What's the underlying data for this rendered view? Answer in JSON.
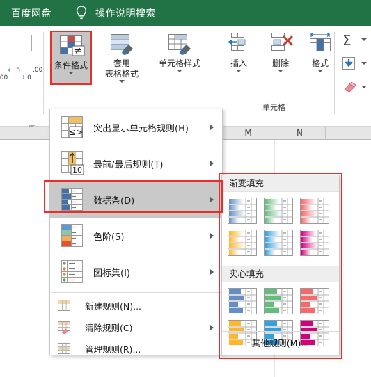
{
  "titlebar": {
    "app_name": "百度网盘",
    "bulb_icon": "lightbulb-icon",
    "tell_me": "操作说明搜索",
    "background_color": "#217346"
  },
  "ribbon": {
    "decimal_increase": "←.0\n.00",
    "decimal_decrease": ".00\n→.0",
    "buttons": [
      {
        "id": "conditional-formatting",
        "label": "条件格式",
        "selected": true
      },
      {
        "id": "format-as-table",
        "label_line1": "套用",
        "label_line2": "表格格式",
        "selected": false
      },
      {
        "id": "cell-styles",
        "label": "单元格样式",
        "selected": false
      },
      {
        "id": "insert",
        "label": "插入",
        "selected": false
      },
      {
        "id": "delete",
        "label": "删除",
        "selected": false
      },
      {
        "id": "format",
        "label": "格式",
        "selected": false
      }
    ],
    "group_label_cells": "单元格",
    "edit_icons": [
      {
        "id": "autosum",
        "glyph": "Σ"
      },
      {
        "id": "fill-down",
        "glyph": "↓"
      },
      {
        "id": "clear-eraser",
        "glyph": "eraser"
      }
    ]
  },
  "sheet": {
    "column_headers": [
      "M",
      "N"
    ]
  },
  "menu": {
    "items": [
      {
        "id": "highlight-cells-rules",
        "label": "突出显示单元格规则(H)",
        "has_submenu": true,
        "highlighted": false
      },
      {
        "id": "top-bottom-rules",
        "label": "最前/最后规则(T)",
        "has_submenu": true,
        "highlighted": false
      },
      {
        "id": "data-bars",
        "label": "数据条(D)",
        "has_submenu": true,
        "highlighted": true
      },
      {
        "id": "color-scales",
        "label": "色阶(S)",
        "has_submenu": true,
        "highlighted": false
      },
      {
        "id": "icon-sets",
        "label": "图标集(I)",
        "has_submenu": true,
        "highlighted": false
      }
    ],
    "small_items": [
      {
        "id": "new-rule",
        "label": "新建规则(N)...",
        "has_submenu": false
      },
      {
        "id": "clear-rules",
        "label": "清除规则(C)",
        "has_submenu": true
      },
      {
        "id": "manage-rules",
        "label": "管理规则(R)...",
        "has_submenu": false
      }
    ]
  },
  "submenu": {
    "gradient_header": "渐变填充",
    "solid_header": "实心填充",
    "more_rules": "其他规则(M)...",
    "gradient_swatches": [
      {
        "id": "gradient-blue",
        "color": "#638ec6"
      },
      {
        "id": "gradient-green",
        "color": "#63be7b"
      },
      {
        "id": "gradient-red",
        "color": "#f8696b"
      },
      {
        "id": "gradient-orange",
        "color": "#ffb628"
      },
      {
        "id": "gradient-lightblue",
        "color": "#31a2e0"
      },
      {
        "id": "gradient-purple",
        "color": "#d6007f"
      }
    ],
    "solid_swatches": [
      {
        "id": "solid-blue",
        "color": "#638ec6"
      },
      {
        "id": "solid-green",
        "color": "#63be7b"
      },
      {
        "id": "solid-red",
        "color": "#f8696b"
      },
      {
        "id": "solid-orange",
        "color": "#ffb628"
      },
      {
        "id": "solid-lightblue",
        "color": "#31a2e0"
      },
      {
        "id": "solid-purple",
        "color": "#d6007f"
      }
    ]
  },
  "annotations": {
    "accent_color": "#e8302a",
    "boxes": [
      {
        "id": "annotation-conditional-formatting"
      },
      {
        "id": "annotation-data-bars"
      },
      {
        "id": "annotation-data-bars-submenu"
      }
    ]
  }
}
